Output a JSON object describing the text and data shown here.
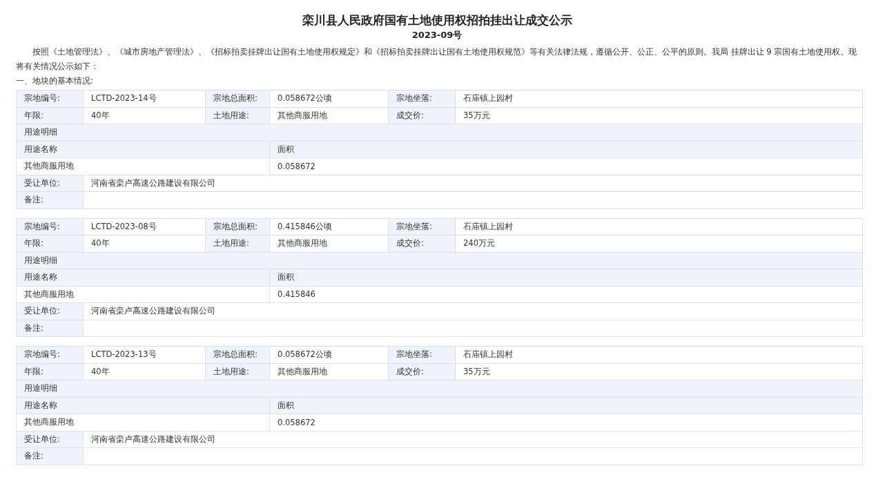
{
  "title": "栾川县人民政府国有土地使用权招拍挂出让成交公示",
  "subtitle": "2023-09号",
  "intro": "按照《土地管理法》、《城市房地产管理法》、《招标拍卖挂牌出让国有土地使用权规定》和《招标拍卖挂牌出让国有土地使用权规范》等有关法律法规，遵循公开、公正、公平的原则。我局 挂牌出让 9 宗国有土地使用权。现将有关情况公示如下：",
  "section_heading": "一、地块的基本情况:",
  "parcels": [
    {
      "rows": [
        [
          {
            "label": "宗地编号:",
            "value": "LCTD-2023-14号"
          },
          {
            "label": "宗地总面积:",
            "value": "0.058672公顷"
          },
          {
            "label": "宗地坐落:",
            "value": "石庙镇上园村"
          }
        ],
        [
          {
            "label": "年限:",
            "value": "40年"
          },
          {
            "label": "土地用途:",
            "value": "其他商服用地"
          },
          {
            "label": "成交价:",
            "value": "35万元"
          }
        ]
      ],
      "usage_title": "用途明细",
      "usage_headers": [
        "用途名称",
        "面积"
      ],
      "usage_rows": [
        [
          "其他商服用地",
          "0.058672"
        ]
      ],
      "assignee": {
        "label": "受让单位:",
        "value": "河南省栾卢高速公路建设有限公司"
      },
      "remarks": {
        "label": "备注:"
      }
    },
    {
      "rows": [
        [
          {
            "label": "宗地编号:",
            "value": "LCTD-2023-08号"
          },
          {
            "label": "宗地总面积:",
            "value": "0.415846公顷"
          },
          {
            "label": "宗地坐落:",
            "value": "石庙镇上园村"
          }
        ],
        [
          {
            "label": "年限:",
            "value": "40年"
          },
          {
            "label": "土地用途:",
            "value": "其他商服用地"
          },
          {
            "label": "成交价:",
            "value": "240万元"
          }
        ]
      ],
      "usage_title": "用途明细",
      "usage_headers": [
        "用途名称",
        "面积"
      ],
      "usage_rows": [
        [
          "其他商服用地",
          "0.415846"
        ]
      ],
      "assignee": {
        "label": "受让单位:",
        "value": "河南省栾卢高速公路建设有限公司"
      },
      "remarks": {
        "label": "备注:"
      }
    },
    {
      "rows": [
        [
          {
            "label": "宗地编号:",
            "value": "LCTD-2023-13号"
          },
          {
            "label": "宗地总面积:",
            "value": "0.058672公顷"
          },
          {
            "label": "宗地坐落:",
            "value": "石庙镇上园村"
          }
        ],
        [
          {
            "label": "年限:",
            "value": "40年"
          },
          {
            "label": "土地用途:",
            "value": "其他商服用地"
          },
          {
            "label": "成交价:",
            "value": "35万元"
          }
        ]
      ],
      "usage_title": "用途明细",
      "usage_headers": [
        "用途名称",
        "面积"
      ],
      "usage_rows": [
        [
          "其他商服用地",
          "0.058672"
        ]
      ],
      "assignee": {
        "label": "受让单位:",
        "value": "河南省栾卢高速公路建设有限公司"
      },
      "remarks": {
        "label": "备注:"
      }
    }
  ]
}
